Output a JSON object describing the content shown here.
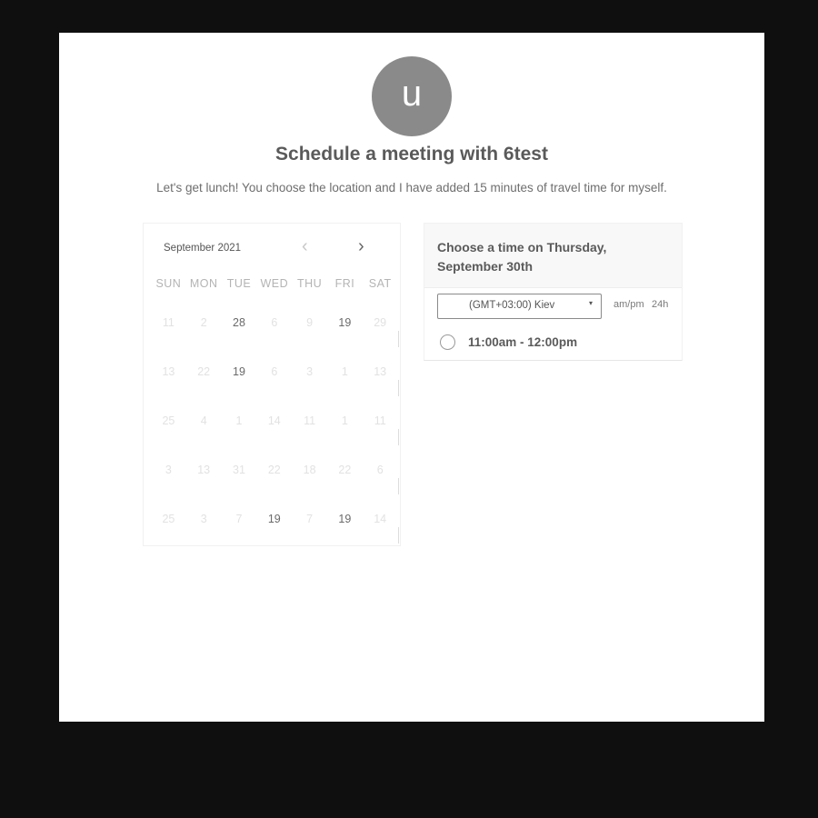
{
  "host": {
    "avatar_letter": "u",
    "title": "Schedule a meeting with 6test",
    "description": "Let's get lunch! You choose the location and I have added 15 minutes of travel time for myself."
  },
  "calendar": {
    "month_label": "September 2021",
    "prev_icon": "‹",
    "next_icon": "›",
    "weekdays": [
      "SUN",
      "MON",
      "TUE",
      "WED",
      "THU",
      "FRI",
      "SAT"
    ],
    "weeks": [
      [
        {
          "label": "11",
          "active": false
        },
        {
          "label": "2",
          "active": false
        },
        {
          "label": "28",
          "active": true
        },
        {
          "label": "6",
          "active": false
        },
        {
          "label": "9",
          "active": false
        },
        {
          "label": "19",
          "active": true
        },
        {
          "label": "29",
          "active": false
        }
      ],
      [
        {
          "label": "13",
          "active": false
        },
        {
          "label": "22",
          "active": false
        },
        {
          "label": "19",
          "active": true
        },
        {
          "label": "6",
          "active": false
        },
        {
          "label": "3",
          "active": false
        },
        {
          "label": "1",
          "active": false
        },
        {
          "label": "13",
          "active": false
        }
      ],
      [
        {
          "label": "25",
          "active": false
        },
        {
          "label": "4",
          "active": false
        },
        {
          "label": "1",
          "active": false
        },
        {
          "label": "14",
          "active": false
        },
        {
          "label": "11",
          "active": false
        },
        {
          "label": "1",
          "active": false
        },
        {
          "label": "11",
          "active": false
        }
      ],
      [
        {
          "label": "3",
          "active": false
        },
        {
          "label": "13",
          "active": false
        },
        {
          "label": "31",
          "active": false
        },
        {
          "label": "22",
          "active": false
        },
        {
          "label": "18",
          "active": false
        },
        {
          "label": "22",
          "active": false
        },
        {
          "label": "6",
          "active": false
        }
      ],
      [
        {
          "label": "25",
          "active": false
        },
        {
          "label": "3",
          "active": false
        },
        {
          "label": "7",
          "active": false
        },
        {
          "label": "19",
          "active": true
        },
        {
          "label": "7",
          "active": false
        },
        {
          "label": "19",
          "active": true
        },
        {
          "label": "14",
          "active": false
        }
      ]
    ]
  },
  "time_panel": {
    "heading": "Choose a time on Thursday, September 30th",
    "timezone": {
      "selected": "(GMT+03:00) Kiev",
      "caret_icon": "▾"
    },
    "format_ampm": "am/pm",
    "format_24h": "24h",
    "slots": [
      {
        "label": "11:00am - 12:00pm"
      }
    ]
  }
}
